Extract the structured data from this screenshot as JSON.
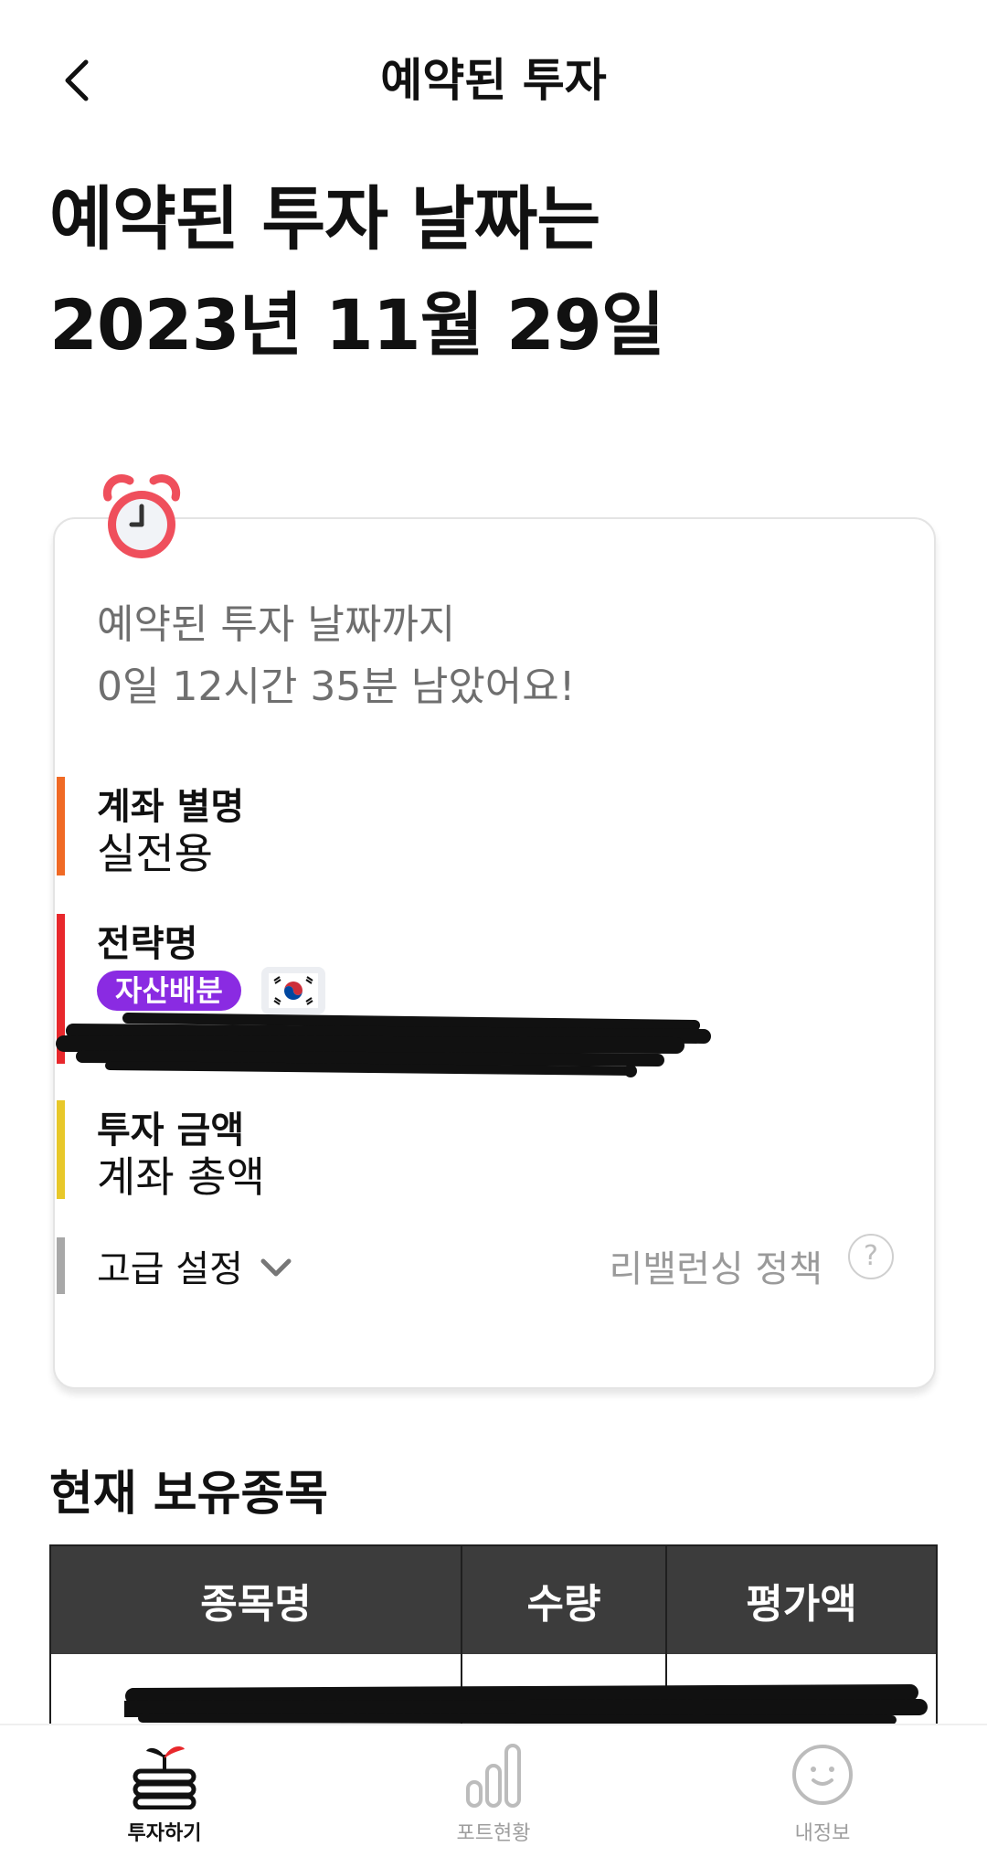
{
  "header": {
    "title": "예약된 투자",
    "back_icon": "chevron-left-icon"
  },
  "hero": {
    "line1": "예약된 투자 날짜는",
    "line2": "2023년 11월 29일"
  },
  "card": {
    "alarm_icon": "alarm-clock-icon",
    "countdown_line1": "예약된 투자 날짜까지",
    "countdown_line2": "0일 12시간 35분 남았어요!",
    "account_alias": {
      "label": "계좌 별명",
      "value": "실전용",
      "bar_color": "#f06a25"
    },
    "strategy": {
      "label": "전략명",
      "chip": "자산배분",
      "chip_color": "#8a2be2",
      "flag_icon": "korea-flag-icon",
      "bar_color": "#e8282c"
    },
    "amount": {
      "label": "투자 금액",
      "value": "계좌 총액",
      "bar_color": "#e8c82a"
    },
    "advanced": {
      "label": "고급 설정",
      "chevron_icon": "chevron-down-icon",
      "policy_label": "리밸런싱 정책",
      "help_icon": "question-circle-icon",
      "bar_color": "#a8a8a8"
    }
  },
  "holdings": {
    "title": "현재 보유종목",
    "columns": [
      "종목명",
      "수량",
      "평가액"
    ]
  },
  "tabbar": {
    "tabs": [
      {
        "label": "투자하기",
        "icon": "sprout-coins-icon",
        "active": true
      },
      {
        "label": "포트현황",
        "icon": "bar-chart-icon",
        "active": false
      },
      {
        "label": "내정보",
        "icon": "smiley-face-icon",
        "active": false
      }
    ]
  }
}
